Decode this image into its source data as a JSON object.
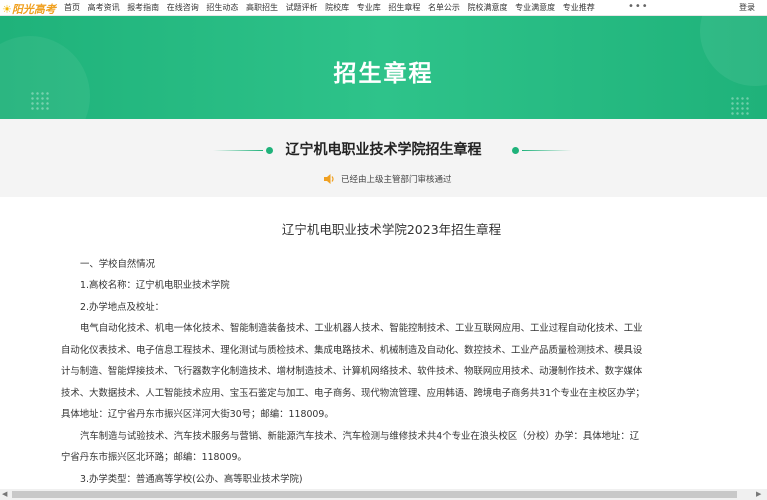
{
  "logo": {
    "text": "阳光高考"
  },
  "nav": {
    "items": [
      "首页",
      "高考资讯",
      "报考指南",
      "在线咨询",
      "招生动态",
      "高职招生",
      "试题评析",
      "院校库",
      "专业库",
      "招生章程",
      "名单公示",
      "院校满意度",
      "专业满意度",
      "专业推荐"
    ],
    "more": "•••",
    "login": "登录"
  },
  "banner": {
    "title": "招生章程"
  },
  "school": {
    "title": "辽宁机电职业技术学院招生章程"
  },
  "audit": {
    "text": "已经由上级主管部门审核通过"
  },
  "doc": {
    "title": "辽宁机电职业技术学院2023年招生章程",
    "lines": [
      "一、学校自然情况",
      "1.高校名称：辽宁机电职业技术学院",
      "2.办学地点及校址：",
      "电气自动化技术、机电一体化技术、智能制造装备技术、工业机器人技术、智能控制技术、工业互联网应用、工业过程自动化技术、工业",
      "自动化仪表技术、电子信息工程技术、理化测试与质检技术、集成电路技术、机械制造及自动化、数控技术、工业产品质量检测技术、模具设",
      "计与制造、智能焊接技术、飞行器数字化制造技术、增材制造技术、计算机网络技术、软件技术、物联网应用技术、动漫制作技术、数字媒体",
      "技术、大数据技术、人工智能技术应用、宝玉石鉴定与加工、电子商务、现代物流管理、应用韩语、跨境电子商务共31个专业在主校区办学；",
      "具体地址：辽宁省丹东市振兴区洋河大街30号；邮编：118009。",
      "汽车制造与试验技术、汽车技术服务与营销、新能源汽车技术、汽车检测与维修技术共4个专业在浪头校区（分校）办学：具体地址：辽",
      "宁省丹东市振兴区北环路；邮编：118009。",
      "3.办学类型：普通高等学校(公办、高等职业技术学院)"
    ]
  },
  "colors": {
    "brand_green": "#1fb27a",
    "logo_orange": "#f0a020"
  }
}
